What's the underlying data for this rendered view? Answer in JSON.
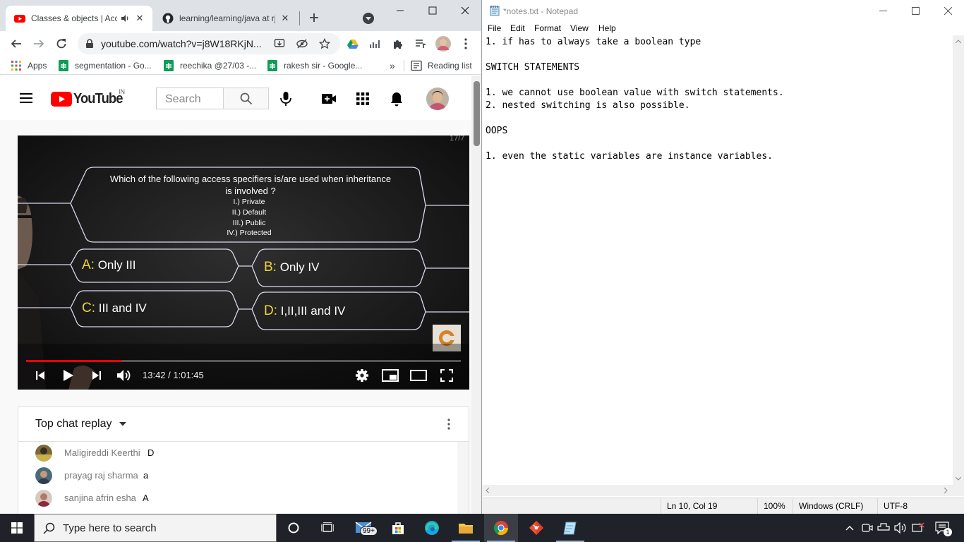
{
  "chrome": {
    "tabs": [
      {
        "title": "Classes & objects | Acc",
        "active": true
      },
      {
        "title": "learning/learning/java at rj",
        "active": false
      }
    ],
    "omnibox": {
      "url": "youtube.com/watch?v=j8W18RKjN..."
    },
    "bookmarks": [
      {
        "label": "Apps",
        "icon": "apps-grid-icon"
      },
      {
        "label": "segmentation - Go...",
        "icon": "google-sheets-icon"
      },
      {
        "label": "reechika @27/03 -...",
        "icon": "google-sheets-icon"
      },
      {
        "label": "rakesh sir - Google...",
        "icon": "google-sheets-icon"
      }
    ],
    "reading_list": "Reading list",
    "more_bookmarks": "»"
  },
  "youtube": {
    "logo_text": "YouTube",
    "country": "IN",
    "search_placeholder": "Search",
    "video": {
      "corner_text": "17/7",
      "question_line1": "Which of the following access specifiers is/are used when inheritance",
      "question_line2": "is involved ?",
      "items": [
        "I.) Private",
        "II.) Default",
        "III.) Public",
        "IV.) Protected"
      ],
      "options": [
        {
          "key": "A:",
          "text": "Only III"
        },
        {
          "key": "B:",
          "text": "Only IV"
        },
        {
          "key": "C:",
          "text": "III and IV"
        },
        {
          "key": "D:",
          "text": "I,II,III and IV"
        }
      ],
      "time": "13:42 / 1:01:45",
      "progress": 0.22
    },
    "chat": {
      "header": "Top chat replay",
      "messages": [
        {
          "author": "Maligireddi Keerthi",
          "text": "D"
        },
        {
          "author": "prayag raj sharma",
          "text": "a"
        },
        {
          "author": "sanjina afrin esha",
          "text": "A"
        }
      ]
    }
  },
  "notepad": {
    "title": "*notes.txt - Notepad",
    "menu": [
      "File",
      "Edit",
      "Format",
      "View",
      "Help"
    ],
    "lines": [
      "1. if has to always take a boolean type",
      "",
      "SWITCH STATEMENTS",
      "",
      "1. we cannot use boolean value with switch statements.",
      "2. nested switching is also possible.",
      "",
      "OOPS",
      "",
      "1. even the static variables are instance variables."
    ],
    "status": {
      "position": "Ln 10, Col 19",
      "zoom": "100%",
      "line_ending": "Windows (CRLF)",
      "encoding": "UTF-8"
    }
  },
  "taskbar": {
    "search_placeholder": "Type here to search",
    "mail_badge": "99+",
    "notification_count": "1"
  },
  "colors": {
    "youtube_red": "#ff0000",
    "chrome_tabstrip": "#dee1e6",
    "taskbar": "#1f2228",
    "answer_key": "#f0d43a"
  }
}
